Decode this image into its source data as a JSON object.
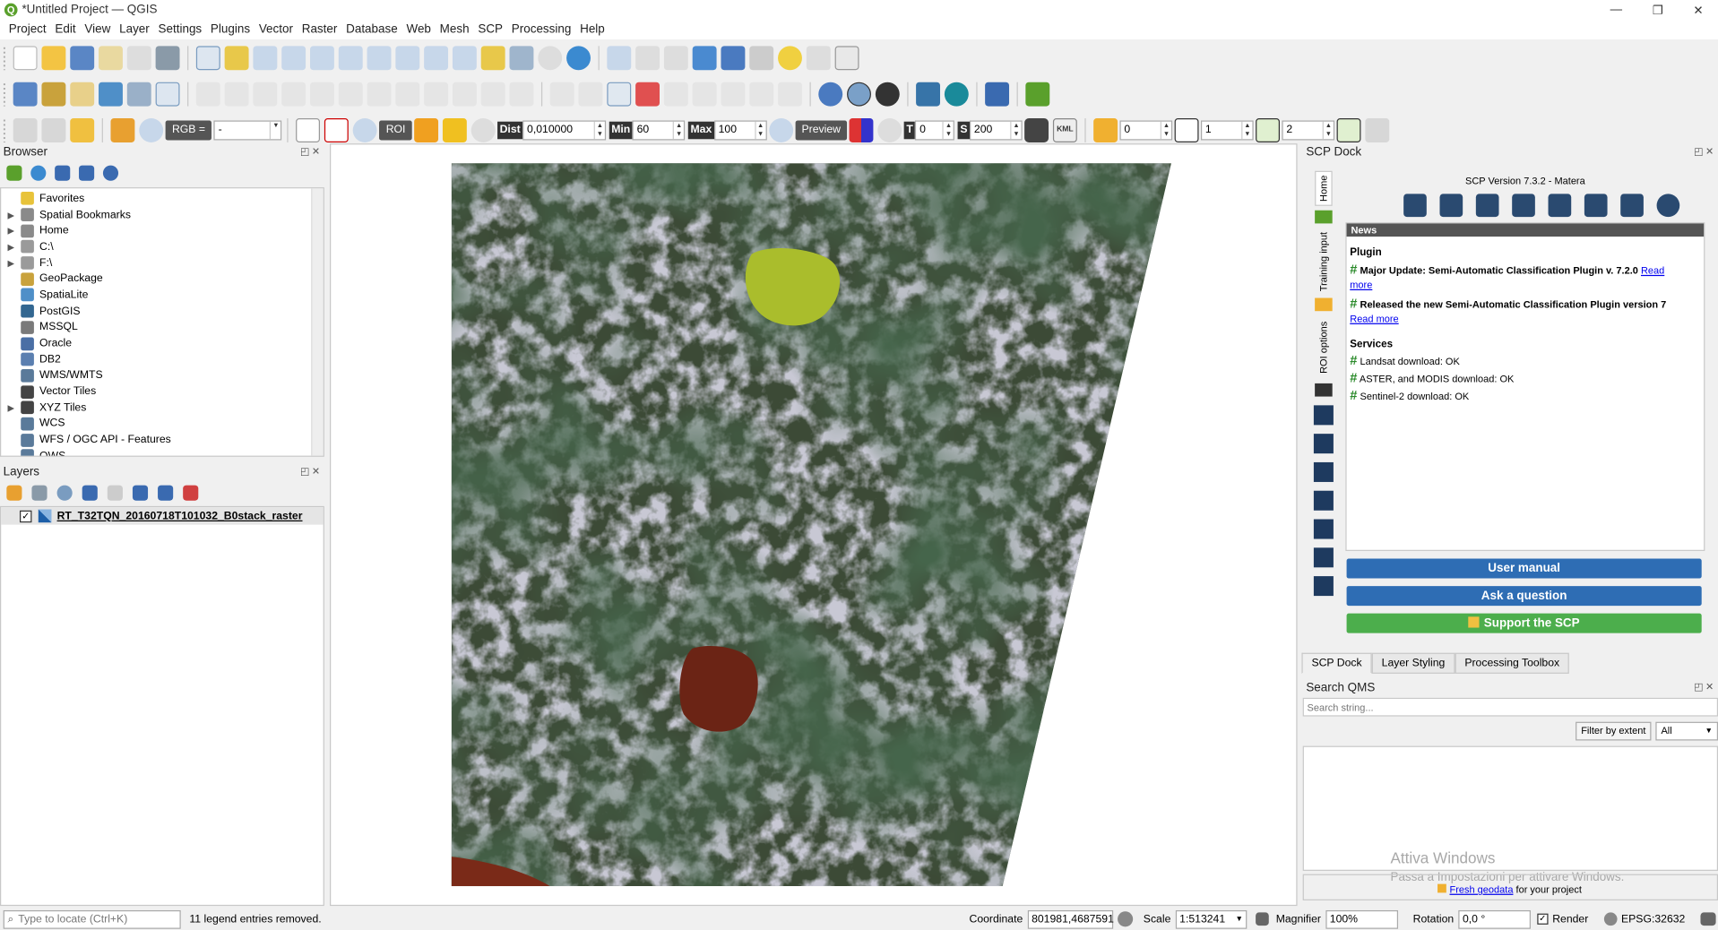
{
  "window": {
    "title": "*Untitled Project — QGIS",
    "logo": "Q",
    "minimize_icon": "—",
    "maximize_icon": "❐",
    "close_icon": "✕"
  },
  "menu": [
    "Project",
    "Edit",
    "View",
    "Layer",
    "Settings",
    "Plugins",
    "Vector",
    "Raster",
    "Database",
    "Web",
    "Mesh",
    "SCP",
    "Processing",
    "Help"
  ],
  "scp_toolbar": {
    "rgb_label": "RGB =",
    "rgb_value": "-",
    "roi_label": "ROI",
    "dist_label": "Dist",
    "dist_value": "0,010000",
    "min_label": "Min",
    "min_value": "60",
    "max_label": "Max",
    "max_value": "100",
    "preview_label": "Preview",
    "t_label": "T",
    "t_value": "0",
    "s_label": "S",
    "s_value": "200",
    "kml_label": "KML",
    "band_values": [
      "0",
      "1",
      "2"
    ]
  },
  "browser": {
    "title": "Browser",
    "items": [
      {
        "label": "Favorites",
        "expandable": false,
        "icon": "star-icon",
        "color": "#e8c33a"
      },
      {
        "label": "Spatial Bookmarks",
        "expandable": true,
        "icon": "bookmark-icon",
        "color": "#8a8a8a"
      },
      {
        "label": "Home",
        "expandable": true,
        "icon": "home-folder-icon",
        "color": "#8a8a8a"
      },
      {
        "label": "C:\\",
        "expandable": true,
        "icon": "drive-icon",
        "color": "#9a9a9a"
      },
      {
        "label": "F:\\",
        "expandable": true,
        "icon": "drive-icon",
        "color": "#9a9a9a"
      },
      {
        "label": "GeoPackage",
        "expandable": false,
        "icon": "geopackage-icon",
        "color": "#c9a23c"
      },
      {
        "label": "SpatiaLite",
        "expandable": false,
        "icon": "spatialite-icon",
        "color": "#4f8fc8"
      },
      {
        "label": "PostGIS",
        "expandable": false,
        "icon": "postgis-icon",
        "color": "#336791"
      },
      {
        "label": "MSSQL",
        "expandable": false,
        "icon": "mssql-icon",
        "color": "#7a7a7a"
      },
      {
        "label": "Oracle",
        "expandable": false,
        "icon": "oracle-icon",
        "color": "#4a6fa5"
      },
      {
        "label": "DB2",
        "expandable": false,
        "icon": "db2-icon",
        "color": "#5b7fb0"
      },
      {
        "label": "WMS/WMTS",
        "expandable": false,
        "icon": "globe-icon",
        "color": "#5a7a9a"
      },
      {
        "label": "Vector Tiles",
        "expandable": false,
        "icon": "grid-icon",
        "color": "#444444"
      },
      {
        "label": "XYZ Tiles",
        "expandable": true,
        "icon": "grid-icon",
        "color": "#444444"
      },
      {
        "label": "WCS",
        "expandable": false,
        "icon": "globe-icon",
        "color": "#5a7a9a"
      },
      {
        "label": "WFS / OGC API - Features",
        "expandable": false,
        "icon": "globe-icon",
        "color": "#5a7a9a"
      },
      {
        "label": "OWS",
        "expandable": false,
        "icon": "globe-icon",
        "color": "#5a7a9a"
      }
    ]
  },
  "layers": {
    "title": "Layers",
    "items": [
      {
        "label": "RT_T32TQN_20160718T101032_B0stack_raster",
        "checked": true
      }
    ]
  },
  "scp": {
    "title": "SCP Dock",
    "version": "SCP Version 7.3.2 - Matera",
    "side_tabs": [
      "Home",
      "Training input",
      "ROI options"
    ],
    "news_header": "News",
    "plugin_heading": "Plugin",
    "news": [
      {
        "text": "Major Update: Semi-Automatic Classification Plugin v. 7.2.0",
        "link_inline": "Read",
        "link_wrap": "more"
      },
      {
        "text": "Released the new Semi-Automatic Classification Plugin version 7",
        "link_inline": "",
        "link_wrap": "Read more"
      }
    ],
    "services_heading": "Services",
    "services": [
      "Landsat download: OK",
      "ASTER, and MODIS download: OK",
      "Sentinel-2 download: OK"
    ],
    "buttons": {
      "manual": "User manual",
      "question": "Ask a question",
      "support": "Support the SCP"
    },
    "colors": {
      "blue": "#2e6db4",
      "green": "#4cae4c",
      "news_header": "#555555"
    }
  },
  "bottom_tabs": [
    "SCP Dock",
    "Layer Styling",
    "Processing Toolbox"
  ],
  "qms": {
    "title": "Search QMS",
    "placeholder": "Search string...",
    "filter_button": "Filter by extent",
    "filter_select": "All",
    "watermark_title": "Attiva Windows",
    "watermark_sub": "Passa a Impostazioni per attivare Windows.",
    "geodata_link": "Fresh geodata",
    "geodata_suffix": " for your project"
  },
  "status": {
    "locate_placeholder": "Type to locate (Ctrl+K)",
    "message": "11 legend entries removed.",
    "coordinate_label": "Coordinate",
    "coordinate_value": "801981,4687591",
    "scale_label": "Scale",
    "scale_value": "1:513241",
    "magnifier_label": "Magnifier",
    "magnifier_value": "100%",
    "rotation_label": "Rotation",
    "rotation_value": "0,0 °",
    "render_label": "Render",
    "crs": "EPSG:32632"
  }
}
